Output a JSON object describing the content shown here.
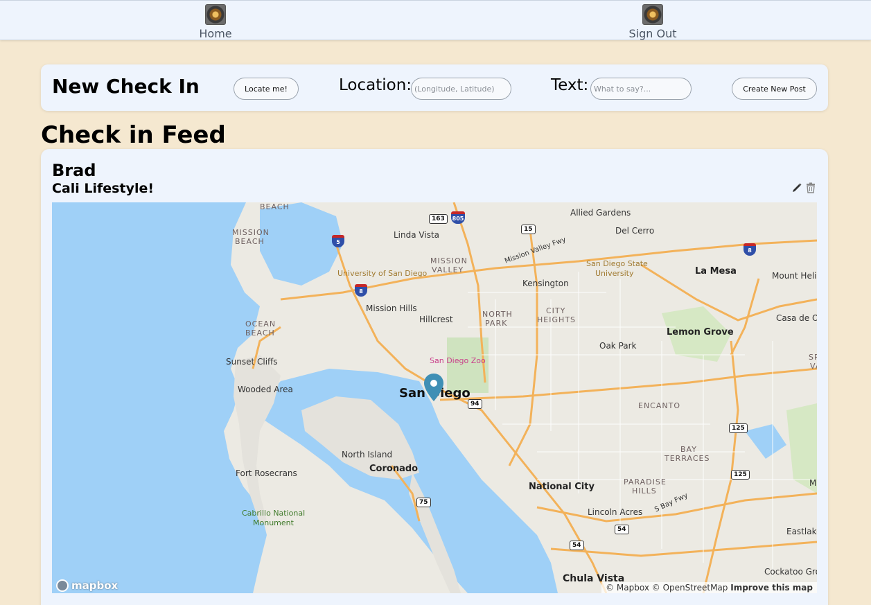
{
  "nav": {
    "home_label": "Home",
    "signout_label": "Sign Out"
  },
  "checkin": {
    "title": "New Check In",
    "locate_button": "Locate me!",
    "location_label": "Location:",
    "location_placeholder": "(Longitude, Latitude)",
    "text_label": "Text:",
    "text_placeholder": "What to say?...",
    "create_button": "Create New Post"
  },
  "feed": {
    "title": "Check in Feed",
    "posts": [
      {
        "author": "Brad",
        "text": "Cali Lifestyle!"
      }
    ]
  },
  "map": {
    "labels": {
      "san_diego": "San Diego",
      "la_mesa": "La Mesa",
      "lemon_grove": "Lemon Grove",
      "national_city": "National City",
      "chula_vista": "Chula Vista",
      "coronado": "Coronado",
      "north_island": "North Island",
      "fort_rosecrans": "Fort Rosecrans",
      "cabrillo": "Cabrillo National",
      "cabrillo2": "Monument",
      "sunset_cliffs": "Sunset Cliffs",
      "wooded_area": "Wooded Area",
      "ocean_beach": "OCEAN",
      "ocean_beach2": "BEACH",
      "mission_beach": "MISSION",
      "mission_beach2": "BEACH",
      "beach_top": "BEACH",
      "linda_vista": "Linda Vista",
      "mission_valley": "MISSION",
      "mission_valley2": "VALLEY",
      "usd": "University of San Diego",
      "mission_hills": "Mission Hills",
      "hillcrest": "Hillcrest",
      "north_park": "NORTH",
      "north_park2": "PARK",
      "city_heights": "CITY",
      "city_heights2": "HEIGHTS",
      "kensington": "Kensington",
      "allied_gardens": "Allied Gardens",
      "del_cerro": "Del Cerro",
      "sdsu": "San Diego State",
      "sdsu2": "University",
      "mount_helix": "Mount Helix",
      "casa_de_oro": "Casa de Oro",
      "oak_park": "Oak Park",
      "encanto": "ENCANTO",
      "bay_terraces": "BAY",
      "bay_terraces2": "TERRACES",
      "paradise_hills": "PARADISE",
      "paradise_hills2": "HILLS",
      "lincoln_acres": "Lincoln Acres",
      "eastlake": "Eastlake",
      "cockatoo_grove": "Cockatoo Grove",
      "spring_valley": "SPR",
      "spring_valley2": "VAL",
      "monte": "Mo",
      "zoo": "San Diego Zoo",
      "mission_valley_fwy": "Mission Valley Fwy",
      "s_bay_fwy": "S Bay Fwy"
    },
    "shields": {
      "s163": "163",
      "s805": "805",
      "s15": "15",
      "s5": "5",
      "s8a": "8",
      "s8b": "8",
      "s94": "94",
      "s125a": "125",
      "s125b": "125",
      "s75": "75",
      "s54a": "54",
      "s54b": "54"
    },
    "logo": "mapbox",
    "attribution_1": "© Mapbox © OpenStreetMap",
    "attribution_2": "Improve this map",
    "water_color": "#9fd0f7",
    "land_color": "#eceae3",
    "road_color": "#f3b25a",
    "pin_color": "#3f8fb5"
  }
}
